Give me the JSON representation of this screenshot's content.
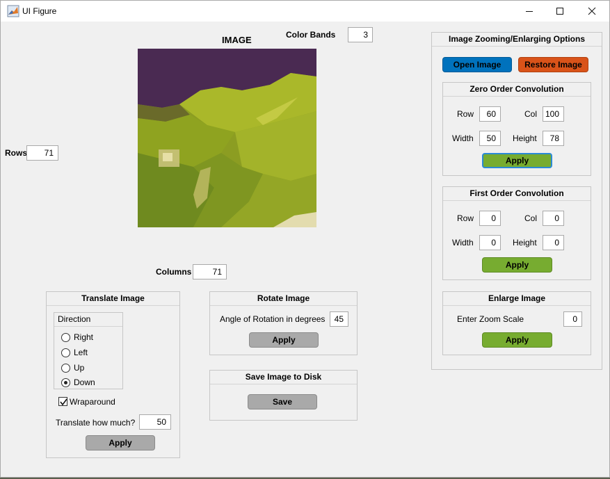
{
  "window": {
    "title": "UI Figure"
  },
  "main": {
    "image_title": "IMAGE",
    "color_bands_label": "Color Bands",
    "color_bands_value": "3",
    "rows_label": "Rows",
    "rows_value": "71",
    "columns_label": "Columns",
    "columns_value": "71"
  },
  "translate": {
    "title": "Translate Image",
    "direction_title": "Direction",
    "options": [
      "Right",
      "Left",
      "Up",
      "Down"
    ],
    "selected": "Down",
    "wraparound_label": "Wraparound",
    "wraparound_checked": true,
    "amount_label": "Translate how much?",
    "amount_value": "50",
    "apply_label": "Apply"
  },
  "rotate": {
    "title": "Rotate Image",
    "angle_label": "Angle of Rotation in degrees",
    "angle_value": "45",
    "apply_label": "Apply"
  },
  "save": {
    "title": "Save Image to Disk",
    "save_label": "Save"
  },
  "zoom": {
    "title": "Image Zooming/Enlarging Options",
    "open_label": "Open Image",
    "restore_label": "Restore Image",
    "zero_order": {
      "title": "Zero Order Convolution",
      "row_label": "Row",
      "row_value": "60",
      "col_label": "Col",
      "col_value": "100",
      "width_label": "Width",
      "width_value": "50",
      "height_label": "Height",
      "height_value": "78",
      "apply_label": "Apply"
    },
    "first_order": {
      "title": "First Order Convolution",
      "row_label": "Row",
      "row_value": "0",
      "col_label": "Col",
      "col_value": "0",
      "width_label": "Width",
      "width_value": "0",
      "height_label": "Height",
      "height_value": "0",
      "apply_label": "Apply"
    },
    "enlarge": {
      "title": "Enlarge Image",
      "scale_label": "Enter Zoom Scale",
      "scale_value": "0",
      "apply_label": "Apply"
    }
  },
  "colors": {
    "panel_bg": "#f0f0f0",
    "button_gray": "#a9a9a9",
    "button_green": "#77ac30",
    "button_blue": "#0072bd",
    "button_orange": "#d95319",
    "focus_ring": "#2b8ad6"
  },
  "icons": {
    "app": "matlab-icon",
    "minimize": "minimize-icon",
    "maximize": "maximize-icon",
    "close": "close-icon"
  }
}
